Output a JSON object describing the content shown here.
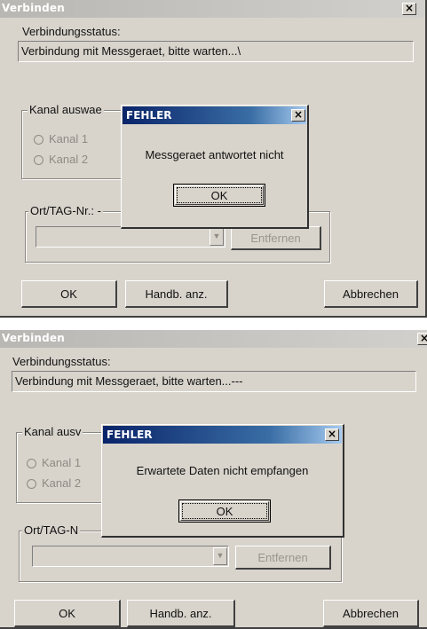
{
  "screens": [
    {
      "window_title": "Verbinden",
      "close_glyph": "×",
      "status_label": "Verbindungsstatus:",
      "status_value": "Verbindung mit Messgeraet, bitte warten...\\",
      "channel_group_label": "Kanal auswae",
      "channel_options": [
        "Kanal 1",
        "Kanal 2"
      ],
      "location_group_label": "Ort/TAG-Nr.: -",
      "combo_arrow": "▼",
      "remove_button": "Entfernen",
      "ok_button": "OK",
      "manual_button": "Handb. anz.",
      "cancel_button": "Abbrechen",
      "error_dialog": {
        "title": "FEHLER",
        "message": "Messgeraet antwortet nicht",
        "ok_button": "OK"
      }
    },
    {
      "window_title": "Verbinden",
      "close_glyph": "×",
      "status_label": "Verbindungsstatus:",
      "status_value": "Verbindung mit Messgeraet, bitte warten...---",
      "channel_group_label": "Kanal ausv",
      "channel_options": [
        "Kanal 1",
        "Kanal 2"
      ],
      "location_group_label": "Ort/TAG-N",
      "combo_arrow": "▼",
      "remove_button": "Entfernen",
      "ok_button": "OK",
      "manual_button": "Handb. anz.",
      "cancel_button": "Abbrechen",
      "error_dialog": {
        "title": "FEHLER",
        "message": "Erwartete Daten nicht empfangen",
        "ok_button": "OK"
      }
    }
  ]
}
